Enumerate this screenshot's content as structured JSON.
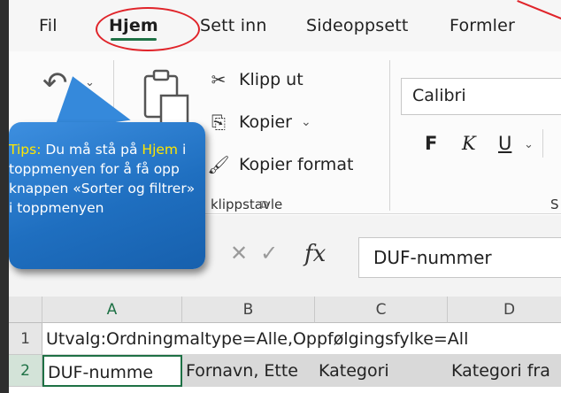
{
  "tabs": [
    {
      "label": "Fil",
      "active": false
    },
    {
      "label": "Hjem",
      "active": true
    },
    {
      "label": "Sett inn",
      "active": false
    },
    {
      "label": "Sideoppsett",
      "active": false
    },
    {
      "label": "Formler",
      "active": false
    }
  ],
  "ribbon": {
    "cut_label": "Klipp ut",
    "copy_label": "Kopier",
    "format_painter_label": "Kopier format",
    "clipboard_group_label": "Utklippstavle",
    "clipboard_group_visible": "klippstavle",
    "font_name": "Calibri",
    "bold": "F",
    "italic": "K",
    "underline": "U",
    "font_group_partial": "S"
  },
  "formula_bar": {
    "fx": "fx",
    "value": "DUF-nummer"
  },
  "columns": [
    "A",
    "B",
    "C",
    "D"
  ],
  "rows": [
    {
      "num": "1",
      "cells": [
        "Utvalg:Ordningmaltype=Alle,Oppfølgingsfylke=All"
      ]
    },
    {
      "num": "2",
      "cells": [
        "DUF-numme",
        "Fornavn, Ette",
        "Kategori",
        "Kategori fra"
      ]
    }
  ],
  "callout": {
    "prefix": "Tips:",
    "text1": " Du må stå på ",
    "highlight": "Hjem",
    "text2": " i toppmenyen for å få opp knappen «Sorter og filtrer» i toppmenyen"
  },
  "colors": {
    "accent_green": "#1e7145",
    "annotation_red": "#e0242a",
    "callout_blue": "#1f6fc0",
    "callout_highlight": "#ffe600"
  }
}
